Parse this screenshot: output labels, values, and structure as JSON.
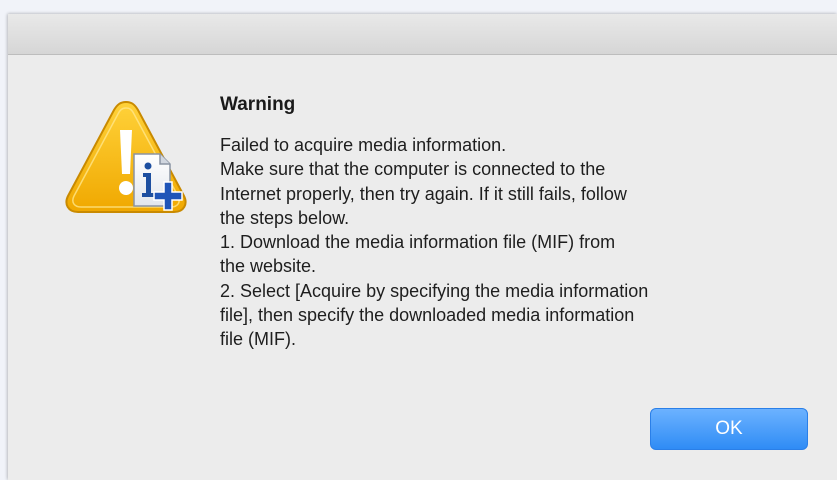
{
  "dialog": {
    "title": "Warning",
    "message_lines": [
      "Failed to acquire media information.",
      "Make sure that the computer is connected to the",
      "Internet properly, then try again. If it still fails, follow",
      "the steps below.",
      "1. Download the media information file (MIF) from",
      "the website.",
      "2. Select [Acquire by specifying the media information",
      "file], then specify the downloaded media information",
      "file (MIF)."
    ],
    "ok_label": "OK",
    "icon": "warning-info-add-icon"
  },
  "colors": {
    "accent_button": "#2f8cf5",
    "warning_yellow": "#f5b400",
    "dialog_bg": "#ececec"
  }
}
